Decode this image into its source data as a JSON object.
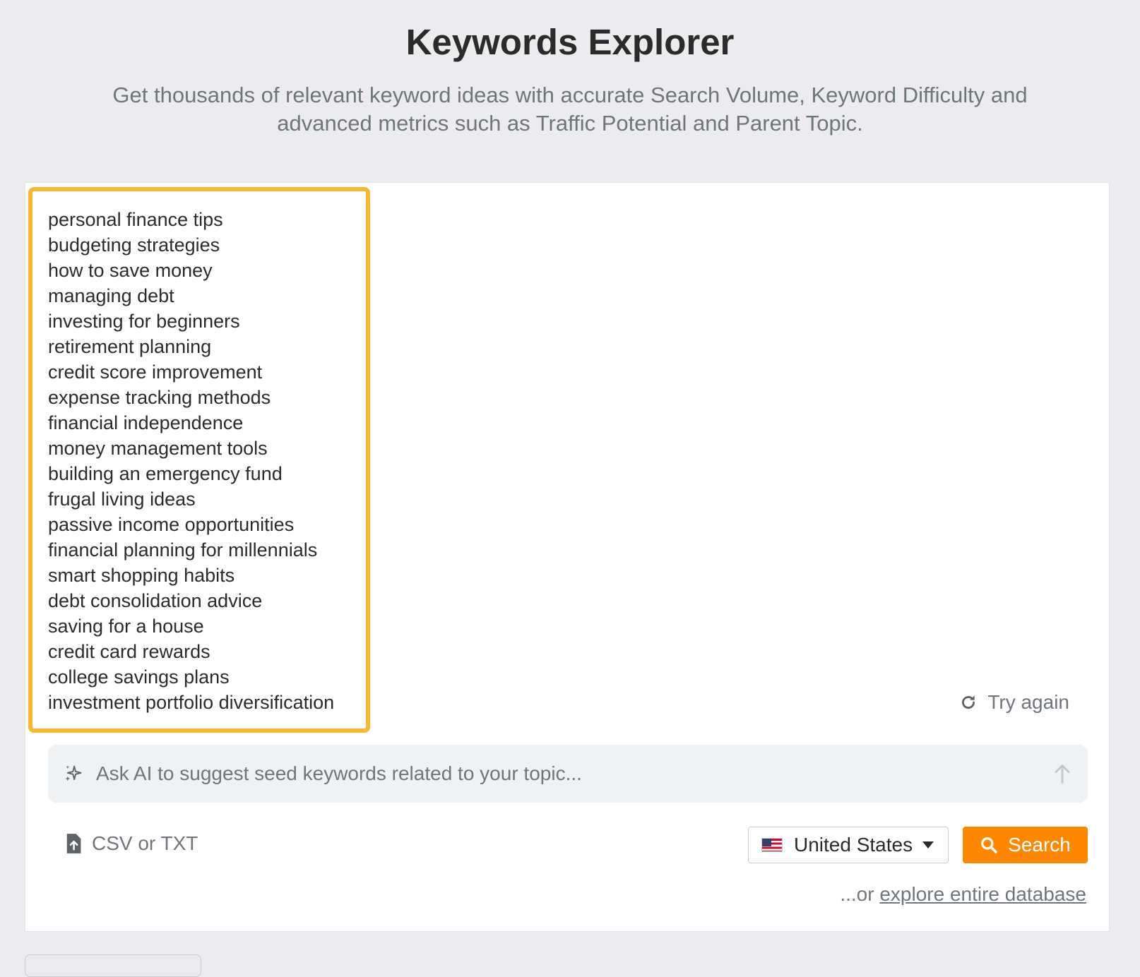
{
  "header": {
    "title": "Keywords Explorer",
    "subtitle": "Get thousands of relevant keyword ideas with accurate Search Volume, Keyword Difficulty and advanced metrics such as Traffic Potential and Parent Topic."
  },
  "keywords": [
    "personal finance tips",
    "budgeting strategies",
    "how to save money",
    "managing debt",
    "investing for beginners",
    "retirement planning",
    "credit score improvement",
    "expense tracking methods",
    "financial independence",
    "money management tools",
    "building an emergency fund",
    "frugal living ideas",
    "passive income opportunities",
    "financial planning for millennials",
    "smart shopping habits",
    "debt consolidation advice",
    "saving for a house",
    "credit card rewards",
    "college savings plans",
    "investment portfolio diversification"
  ],
  "try_again_label": "Try again",
  "ai_prompt": {
    "placeholder": "Ask AI to suggest seed keywords related to your topic...",
    "value": ""
  },
  "upload_label": "CSV or TXT",
  "country": {
    "selected": "United States",
    "flag_icon": "us-flag-icon"
  },
  "search_label": "Search",
  "explore": {
    "prefix": "...or ",
    "link_text": "explore entire database"
  },
  "colors": {
    "accent": "#ff8800",
    "highlight_border": "#f9b733",
    "background": "#ececee"
  }
}
